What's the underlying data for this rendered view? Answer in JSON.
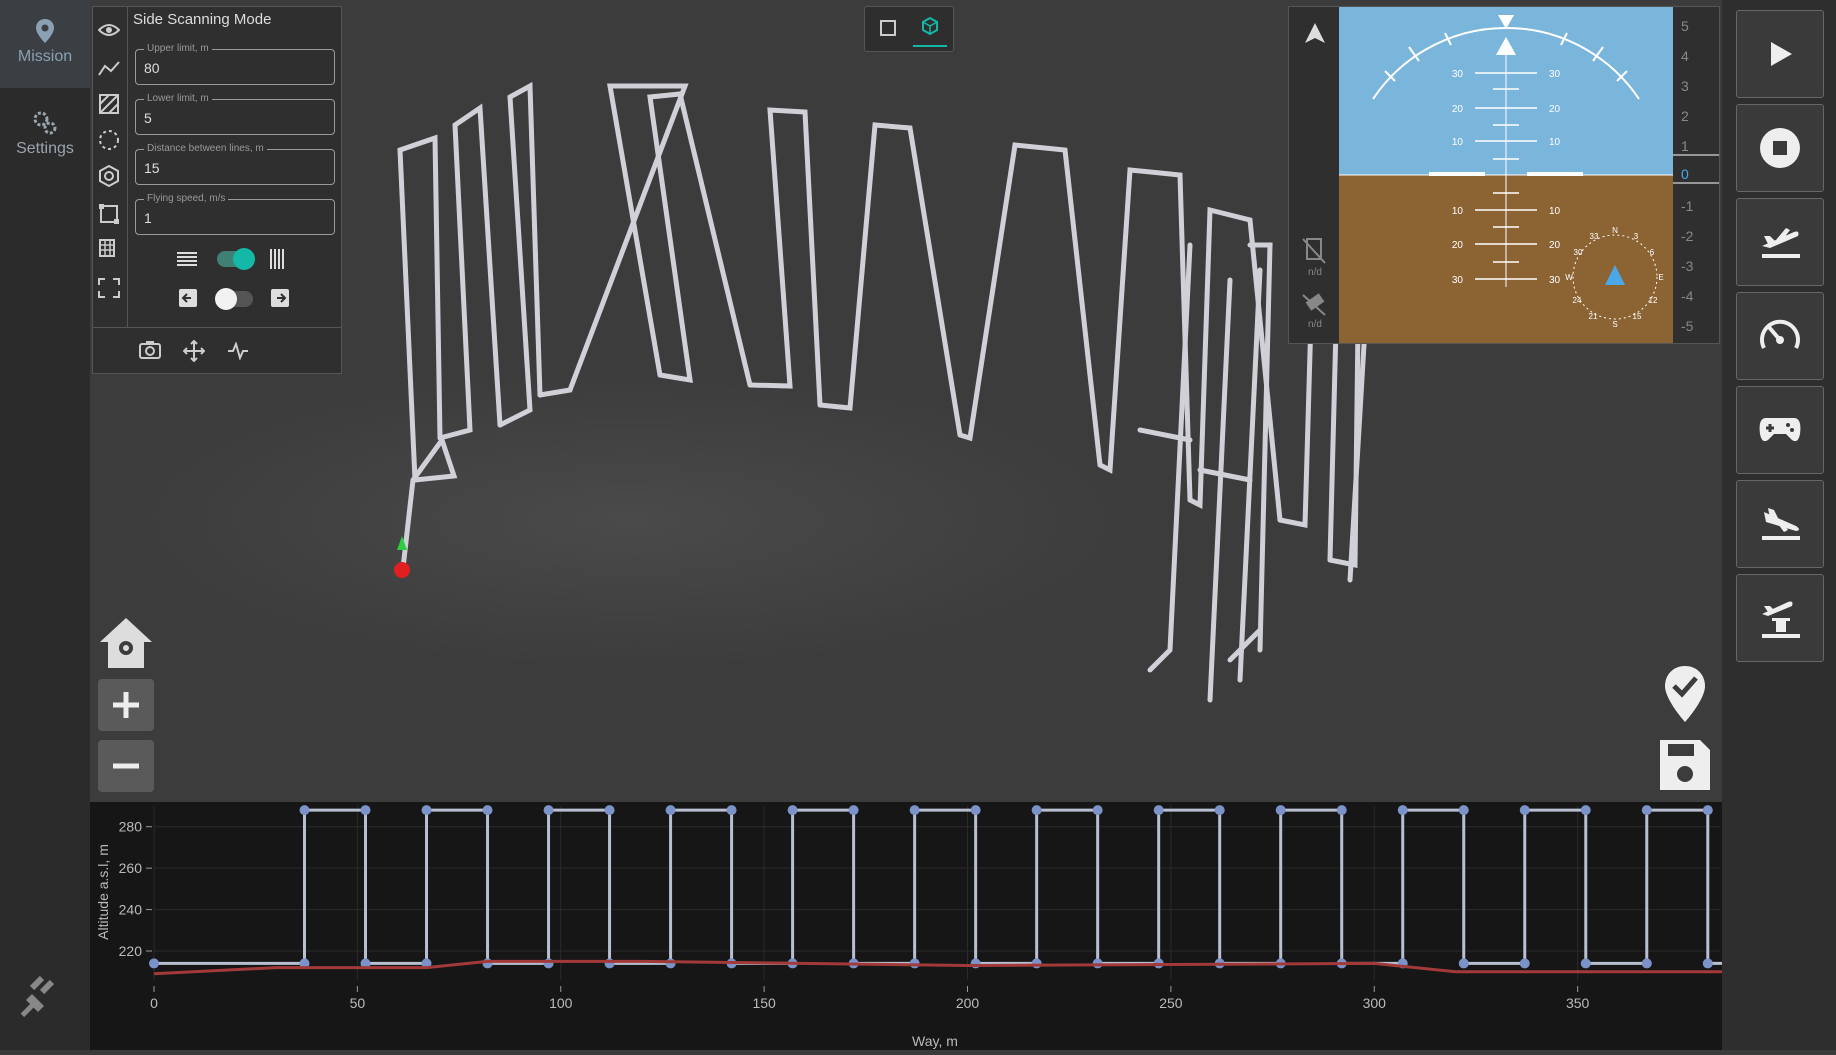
{
  "nav": {
    "mission_label": "Mission",
    "settings_label": "Settings"
  },
  "panel": {
    "title": "Side Scanning Mode",
    "fields": [
      {
        "label": "Upper limit, m",
        "value": "80"
      },
      {
        "label": "Lower limit, m",
        "value": "5"
      },
      {
        "label": "Distance between lines, m",
        "value": "15"
      },
      {
        "label": "Flying speed, m/s",
        "value": "1"
      }
    ]
  },
  "instrument": {
    "pitch_labels": [
      "30",
      "20",
      "10",
      "10",
      "20",
      "30"
    ],
    "vscale": [
      "5",
      "4",
      "3",
      "2",
      "1",
      "0",
      "-1",
      "-2",
      "-3",
      "-4",
      "-5"
    ],
    "battery_value": "n/d",
    "gps_value": "n/d",
    "compass": [
      "N",
      "3",
      "6",
      "E",
      "12",
      "15",
      "S",
      "21",
      "24",
      "W",
      "30",
      "33"
    ]
  },
  "chart_data": {
    "type": "line",
    "xlabel": "Way, m",
    "ylabel": "Altitude a.s.l, m",
    "xticks": [
      0,
      50,
      100,
      150,
      200,
      250,
      300,
      350
    ],
    "yticks": [
      220,
      240,
      260,
      280
    ],
    "xlim": [
      0,
      385
    ],
    "ylim": [
      206,
      290
    ],
    "series": [
      {
        "x": [
          0,
          37,
          37,
          52,
          52,
          67,
          67,
          82,
          82,
          97,
          97,
          112,
          112,
          127,
          127,
          142,
          142,
          157,
          157,
          172,
          172,
          187,
          187,
          202,
          202,
          217,
          217,
          232,
          232,
          247,
          247,
          262,
          262,
          277,
          277,
          292,
          292,
          307,
          307,
          322,
          322,
          337,
          337,
          352,
          352,
          367,
          367,
          382,
          382,
          387
        ],
        "values": [
          214,
          214,
          288,
          288,
          214,
          214,
          288,
          288,
          214,
          214,
          288,
          288,
          214,
          214,
          288,
          288,
          214,
          214,
          288,
          288,
          214,
          214,
          288,
          288,
          214,
          214,
          288,
          288,
          214,
          214,
          288,
          288,
          214,
          214,
          288,
          288,
          214,
          214,
          288,
          288,
          214,
          214,
          288,
          288,
          214,
          214,
          288,
          288,
          214,
          214
        ]
      },
      {
        "x": [
          0,
          30,
          67,
          82,
          120,
          200,
          300,
          320,
          387
        ],
        "values": [
          209,
          212,
          212,
          215,
          215,
          213,
          214,
          210,
          210
        ]
      }
    ],
    "colors": [
      "#b8bfd0",
      "#a33a3a"
    ]
  },
  "colors": {
    "accent": "#14b8a6",
    "marker": "#7b93c8"
  }
}
